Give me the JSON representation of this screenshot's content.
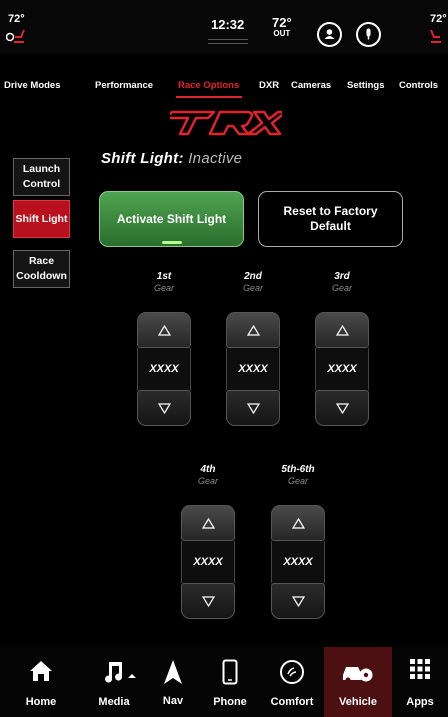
{
  "status": {
    "left_temp": "72°",
    "time": "12:32",
    "outside_temp": "72°",
    "outside_label": "OUT",
    "right_temp": "72°"
  },
  "tabs": [
    "Drive Modes",
    "Performance",
    "Race Options",
    "DXR",
    "Cameras",
    "Settings",
    "Controls"
  ],
  "active_tab": "Race Options",
  "logo_text": "TRX",
  "shift_light": {
    "title": "Shift Light:",
    "state": "Inactive"
  },
  "side_menu": [
    "Launch Control",
    "Shift Light",
    "Race Cooldown"
  ],
  "side_menu_active": "Shift Light",
  "actions": {
    "activate": "Activate Shift Light",
    "reset": "Reset to Factory Default"
  },
  "gears": [
    {
      "name": "1st",
      "sub": "Gear",
      "value": "XXXX"
    },
    {
      "name": "2nd",
      "sub": "Gear",
      "value": "XXXX"
    },
    {
      "name": "3rd",
      "sub": "Gear",
      "value": "XXXX"
    },
    {
      "name": "4th",
      "sub": "Gear",
      "value": "XXXX"
    },
    {
      "name": "5th-6th",
      "sub": "Gear",
      "value": "XXXX"
    }
  ],
  "bottom_nav": [
    {
      "label": "Home",
      "icon": "home-icon"
    },
    {
      "label": "Media",
      "icon": "music-note-icon"
    },
    {
      "label": "Nav",
      "icon": "navigation-arrow-icon"
    },
    {
      "label": "Phone",
      "icon": "phone-icon"
    },
    {
      "label": "Comfort",
      "icon": "comfort-icon"
    },
    {
      "label": "Vehicle",
      "icon": "vehicle-settings-icon"
    },
    {
      "label": "Apps",
      "icon": "apps-grid-icon"
    }
  ],
  "active_nav": "Vehicle",
  "colors": {
    "accent_red": "#e0232c",
    "active_green": "#3f8f41",
    "nav_active_bg": "#4c0f12"
  }
}
